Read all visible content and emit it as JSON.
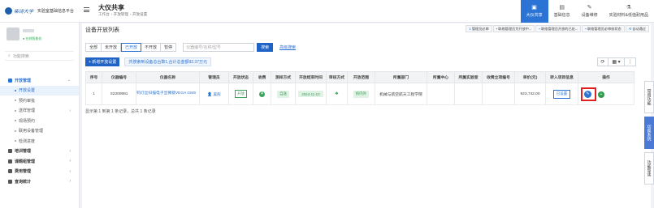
{
  "header": {
    "logo_script": "柴诗大学",
    "logo_text": "实验室基础信息平台",
    "page_title": "大仪共享",
    "breadcrumb": [
      "工作台",
      "开放管理",
      "开放设置"
    ]
  },
  "top_nav": [
    {
      "label": "大仪共享",
      "icon": "instrument-icon",
      "active": true
    },
    {
      "label": "基础信息",
      "icon": "document-icon",
      "active": false
    },
    {
      "label": "设备维修",
      "icon": "wrench-icon",
      "active": false
    },
    {
      "label": "实验材料&低值耐用品",
      "icon": "flask-icon",
      "active": false
    }
  ],
  "sidebar": {
    "online": "● 在线智能化",
    "search_placeholder": "功能搜索",
    "items": [
      {
        "label": "开放管理",
        "type": "group-open",
        "arrow": "⌄"
      },
      {
        "label": "开放设置",
        "type": "sub-active"
      },
      {
        "label": "预约审批",
        "type": "sub"
      },
      {
        "label": "送样管理",
        "type": "sub",
        "arrow": "›"
      },
      {
        "label": "现场预约",
        "type": "sub"
      },
      {
        "label": "联用设备管理",
        "type": "sub"
      },
      {
        "label": "检测进度",
        "type": "sub"
      },
      {
        "label": "培训管理",
        "type": "group",
        "arrow": "›"
      },
      {
        "label": "课题组管理",
        "type": "group",
        "arrow": "›"
      },
      {
        "label": "费用管理",
        "type": "group",
        "arrow": "›"
      },
      {
        "label": "查询统计",
        "type": "group",
        "arrow": "›"
      }
    ]
  },
  "main": {
    "panel_title": "设备开放列表",
    "notices": [
      {
        "prefix": "1",
        "text": "管理员必审"
      },
      {
        "prefix": "▪",
        "text": "联络管理员为开放中..."
      },
      {
        "prefix": "▪",
        "text": "联络管理员开放的已处..."
      },
      {
        "prefix": "▪",
        "text": "联络管理员必审核状态"
      },
      {
        "prefix": "⟲",
        "text": "自动通过"
      }
    ],
    "filters": [
      "全部",
      "未开放",
      "已开放",
      "不开放",
      "暂停"
    ],
    "active_filter": 2,
    "search_placeholder": "仪器编号/名称/型号",
    "search_label": "搜索",
    "advanced_label": "高级搜索",
    "add_label": "+ 新增开放设置",
    "summary": "共搜索到设备总台数1,合计总金额92.37万元",
    "tools": [
      "⟳",
      "▦ ▾",
      "⋮"
    ]
  },
  "table": {
    "headers": [
      "序号",
      "仪器编号",
      "仪器名称",
      "管理员",
      "开放状态",
      "收费",
      "测样方式",
      "开放结束时间",
      "审核方式",
      "开放范围",
      "所属部门",
      "所属中心",
      "所属实验室",
      "收费立项编号",
      "单价(元)",
      "转入项目信息",
      "操作"
    ],
    "rows": [
      {
        "index": "1",
        "code": "S2300981",
        "name": "钨灯丝扫描电子显微镜VEGA GMS",
        "admin": "👤 吴彤",
        "status": "开放",
        "fee_icon": "¥",
        "method": "自送",
        "end_time": "2024-11-10",
        "audit_icon": "♣",
        "scope": "校内外",
        "dept": "机械与航空航天工程学院",
        "center": "",
        "lab": "",
        "fee_no": "",
        "price": "923,742.00",
        "transfer_label": "已设置",
        "op_edit": "✎",
        "op_more": "+"
      }
    ]
  },
  "footer_text": "显示第 1 到第 1 条记录，总共 1 条记录",
  "right_tabs": [
    "常用功能",
    "切换系统",
    "功能导读"
  ],
  "colors": {
    "primary": "#2b73d4",
    "success": "#3aa55a",
    "highlight": "#e02020"
  }
}
